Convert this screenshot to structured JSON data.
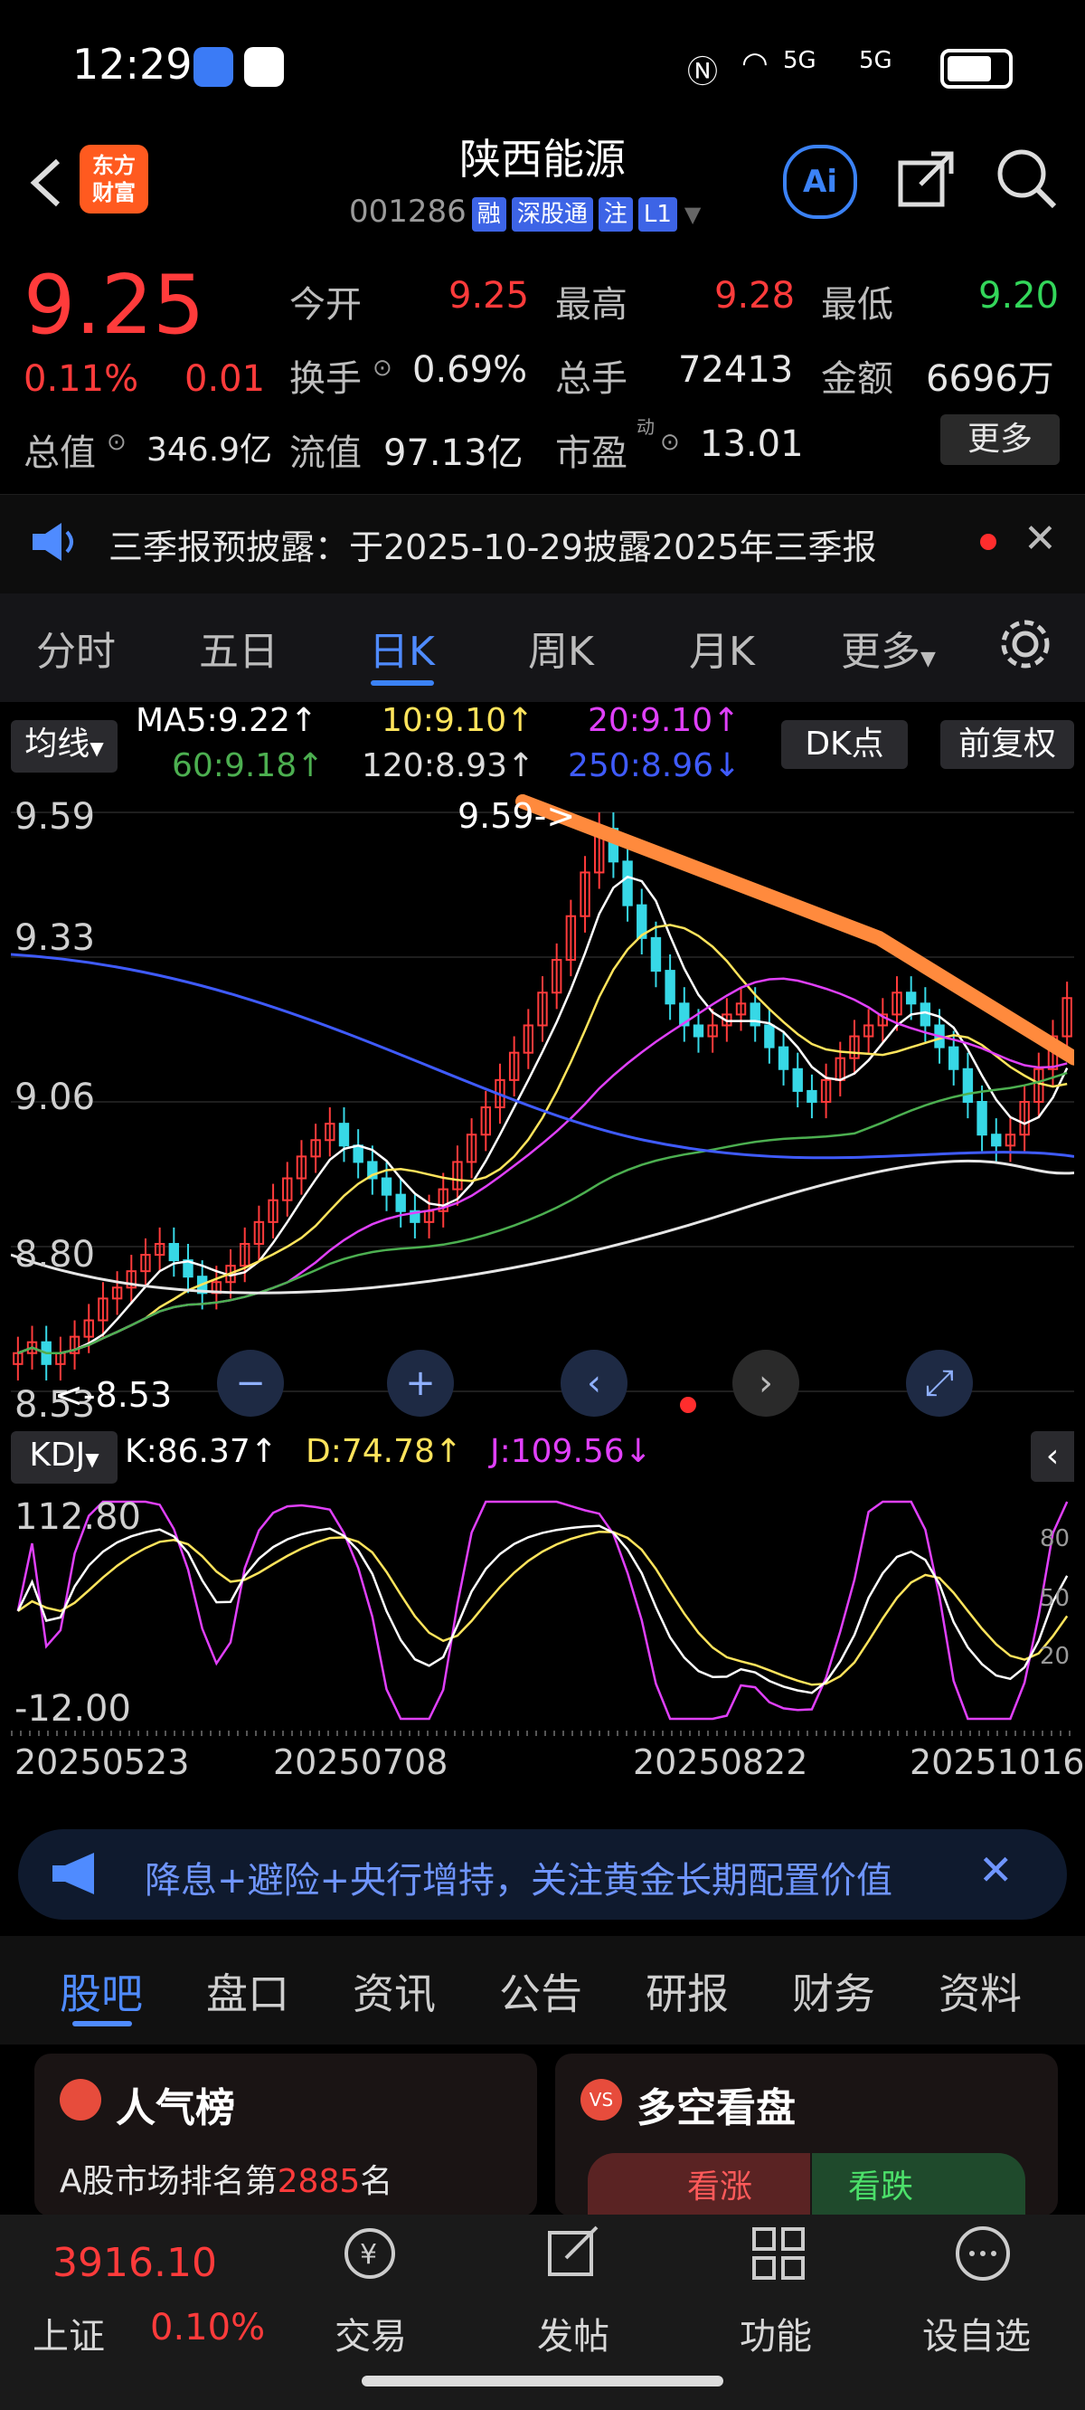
{
  "status": {
    "time": "12:29",
    "signal": "5G"
  },
  "header": {
    "app_logo_line1": "东方",
    "app_logo_line2": "财富",
    "stock_name": "陕西能源",
    "code": "001286",
    "tags": [
      "融",
      "深股通",
      "注",
      "L1"
    ],
    "ai_label": "Ai"
  },
  "quote": {
    "price": "9.25",
    "change_pct": "0.11%",
    "change": "0.01",
    "open_label": "今开",
    "open": "9.25",
    "high_label": "最高",
    "high": "9.28",
    "low_label": "最低",
    "low": "9.20",
    "turnover_label": "换手",
    "turnover": "0.69%",
    "volume_label": "总手",
    "volume": "72413",
    "amount_label": "金额",
    "amount": "6696万",
    "total_value_label": "总值",
    "total_value": "346.9亿",
    "float_value_label": "流值",
    "float_value": "97.13亿",
    "pe_label": "市盈",
    "pe_sup": "动",
    "pe": "13.01",
    "more_label": "更多"
  },
  "notice": {
    "text": "三季报预披露：于2025-10-29披露2025年三季报"
  },
  "period_tabs": [
    "分时",
    "五日",
    "日K",
    "周K",
    "月K",
    "更多"
  ],
  "active_period": "日K",
  "ma": {
    "selector": "均线",
    "ma5": "MA5:9.22↑",
    "ma10": "10:9.10↑",
    "ma20": "20:9.10↑",
    "ma60": "60:9.18↑",
    "ma120": "120:8.93↑",
    "ma250": "250:8.96↓",
    "dk_label": "DK点",
    "adjust_label": "前复权"
  },
  "chart_data": {
    "type": "candlestick",
    "y_ticks": [
      "9.59",
      "9.33",
      "9.06",
      "8.80",
      "8.53"
    ],
    "ylim": [
      8.53,
      9.59
    ],
    "high_marker": "9.59->",
    "low_marker": "<-8.53",
    "closes": [
      8.6,
      8.62,
      8.58,
      8.6,
      8.63,
      8.66,
      8.7,
      8.72,
      8.75,
      8.78,
      8.8,
      8.77,
      8.74,
      8.71,
      8.73,
      8.76,
      8.8,
      8.84,
      8.88,
      8.92,
      8.96,
      8.99,
      9.02,
      8.98,
      8.95,
      8.92,
      8.89,
      8.86,
      8.84,
      8.86,
      8.9,
      8.95,
      9.0,
      9.05,
      9.1,
      9.15,
      9.2,
      9.26,
      9.32,
      9.4,
      9.48,
      9.56,
      9.5,
      9.42,
      9.36,
      9.3,
      9.24,
      9.2,
      9.18,
      9.2,
      9.22,
      9.24,
      9.2,
      9.16,
      9.12,
      9.08,
      9.06,
      9.1,
      9.14,
      9.18,
      9.2,
      9.22,
      9.26,
      9.24,
      9.2,
      9.16,
      9.12,
      9.06,
      9.0,
      8.98,
      9.0,
      9.06,
      9.12,
      9.18,
      9.25
    ]
  },
  "kdj": {
    "label": "KDJ",
    "k": "K:86.37↑",
    "d": "D:74.78↑",
    "j": "J:109.56↓",
    "top": "112.80",
    "bottom": "-12.00",
    "r80": "80",
    "r50": "50",
    "r20": "20"
  },
  "dates": [
    "20250523",
    "20250708",
    "20250822",
    "20251016"
  ],
  "news": {
    "text": "降息+避险+央行增持，关注黄金长期配置价值"
  },
  "bottom_tabs": [
    "股吧",
    "盘口",
    "资讯",
    "公告",
    "研报",
    "财务",
    "资料"
  ],
  "cards": {
    "popularity_title": "人气榜",
    "popularity_prefix": "A股市场排名第",
    "popularity_rank": "2885",
    "popularity_suffix": "名",
    "vs_title": "多空看盘",
    "bull_label": "看涨",
    "bear_label": "看跌"
  },
  "footer": {
    "index_value": "3916.10",
    "index_name": "上证",
    "index_pct": "0.10%",
    "trade": "交易",
    "post": "发帖",
    "function": "功能",
    "watchlist": "设自选"
  },
  "colors": {
    "up": "#ff3b3b",
    "down": "#33d65a",
    "accent": "#3b82f6",
    "trend_line": "#ff8a3d"
  }
}
